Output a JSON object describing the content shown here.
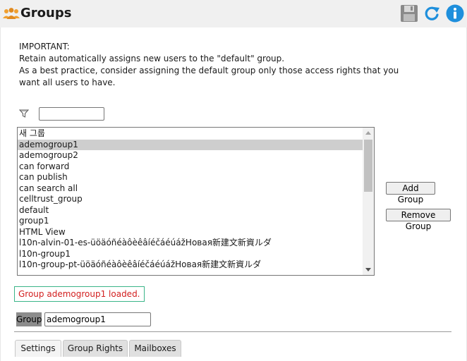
{
  "header": {
    "title": "Groups",
    "icons": {
      "title": "groups-icon",
      "save": "floppy-disk-icon",
      "refresh": "refresh-icon",
      "info": "info-icon"
    },
    "colors": {
      "accent": "#1e8fdc",
      "background": "#f0f0f0"
    }
  },
  "notice": {
    "heading": "IMPORTANT:",
    "line1": "Retain automatically assigns new users to the \"default\" group.",
    "line2": "As a best practice, consider assigning the default group only those access rights that you",
    "line3": "want all users to have."
  },
  "filter": {
    "value": ""
  },
  "group_list": {
    "selected": "ademogroup1",
    "items": [
      "새 그룹",
      "ademogroup1",
      "ademogroup2",
      "can forward",
      "can publish",
      "can search all",
      "celltrust_group",
      "default",
      "group1",
      "HTML View",
      "l10n-alvin-01-es-üöäóñéàôèêâíéčáéúážНовая新建文新資ルダ",
      "l10n-group1",
      "l10n-group-pt-üöäóñéàôèêâíéčáéúážНовая新建文新資ルダ"
    ]
  },
  "buttons": {
    "add_group": "Add Group",
    "remove_group": "Remove Group"
  },
  "status": {
    "message": "Group ademogroup1 loaded.",
    "color": "#d21f1f",
    "border": "#3bb589"
  },
  "group_field": {
    "label": "Group",
    "value": "ademogroup1"
  },
  "tabs": [
    {
      "label": "Settings",
      "active": true
    },
    {
      "label": "Group Rights",
      "active": false
    },
    {
      "label": "Mailboxes",
      "active": false
    }
  ]
}
